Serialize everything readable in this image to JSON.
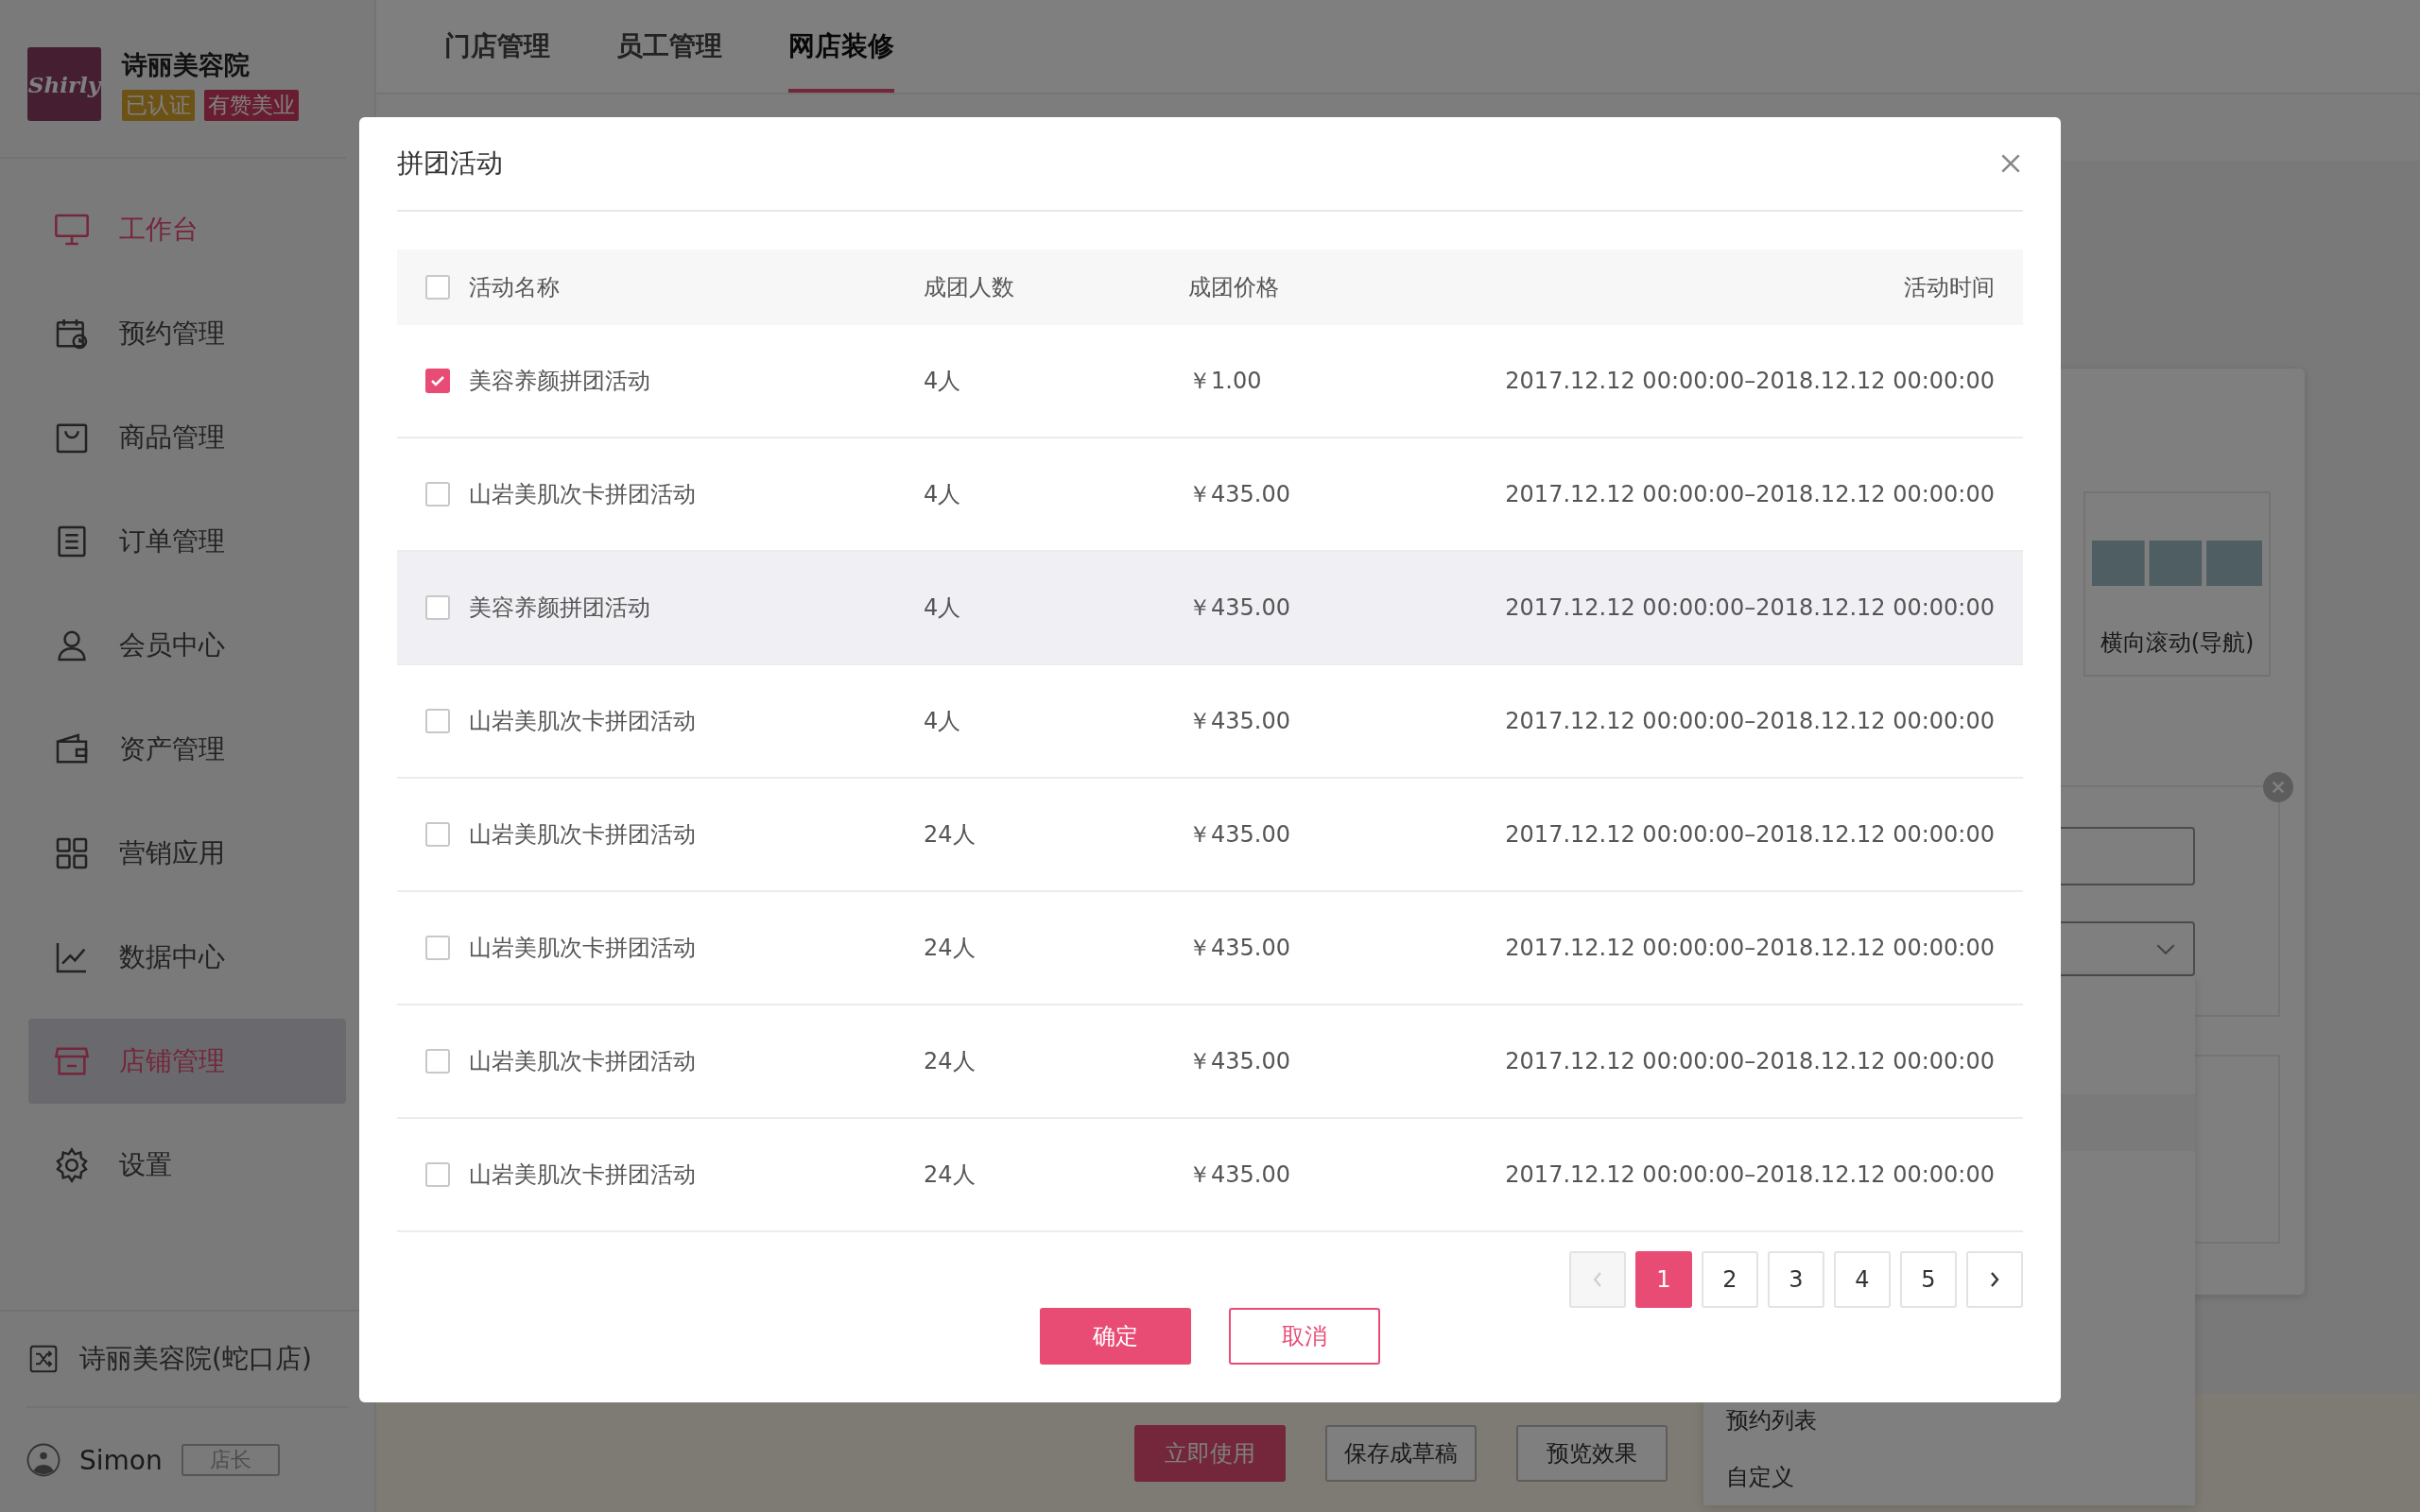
{
  "store": {
    "logo": "Shirly",
    "name": "诗丽美容院",
    "badges": [
      "已认证",
      "有赞美业"
    ]
  },
  "nav": [
    {
      "label": "工作台",
      "active": true,
      "selected": false
    },
    {
      "label": "预约管理",
      "active": false,
      "selected": false
    },
    {
      "label": "商品管理",
      "active": false,
      "selected": false
    },
    {
      "label": "订单管理",
      "active": false,
      "selected": false
    },
    {
      "label": "会员中心",
      "active": false,
      "selected": false
    },
    {
      "label": "资产管理",
      "active": false,
      "selected": false
    },
    {
      "label": "营销应用",
      "active": false,
      "selected": false
    },
    {
      "label": "数据中心",
      "active": false,
      "selected": false
    },
    {
      "label": "店铺管理",
      "active": true,
      "selected": true
    },
    {
      "label": "设置",
      "active": false,
      "selected": false
    }
  ],
  "store_switch": "诗丽美容院(蛇口店)",
  "user": {
    "name": "Simon",
    "role": "店长"
  },
  "tabs": [
    {
      "label": "门店管理",
      "selected": false
    },
    {
      "label": "员工管理",
      "selected": false
    },
    {
      "label": "网店装修",
      "selected": true
    }
  ],
  "component_tile": {
    "label": "横向滚动(导航)"
  },
  "dropdown_items": [
    "预约列表",
    "自定义"
  ],
  "bottom_buttons": [
    {
      "label": "立即使用",
      "kind": "primary"
    },
    {
      "label": "保存成草稿",
      "kind": "default"
    },
    {
      "label": "预览效果",
      "kind": "default"
    }
  ],
  "modal": {
    "title": "拼团活动",
    "columns": [
      "活动名称",
      "成团人数",
      "成团价格",
      "活动时间"
    ],
    "all_checked": false,
    "rows": [
      {
        "name": "美容养颜拼团活动",
        "size": "4人",
        "price": "￥1.00",
        "time": "2017.12.12 00:00:00–2018.12.12 00:00:00",
        "checked": true,
        "hovered": false
      },
      {
        "name": "山岩美肌次卡拼团活动",
        "size": "4人",
        "price": "￥435.00",
        "time": "2017.12.12 00:00:00–2018.12.12 00:00:00",
        "checked": false,
        "hovered": false
      },
      {
        "name": "美容养颜拼团活动",
        "size": "4人",
        "price": "￥435.00",
        "time": "2017.12.12 00:00:00–2018.12.12 00:00:00",
        "checked": false,
        "hovered": true
      },
      {
        "name": "山岩美肌次卡拼团活动",
        "size": "4人",
        "price": "￥435.00",
        "time": "2017.12.12 00:00:00–2018.12.12 00:00:00",
        "checked": false,
        "hovered": false
      },
      {
        "name": "山岩美肌次卡拼团活动",
        "size": "24人",
        "price": "￥435.00",
        "time": "2017.12.12 00:00:00–2018.12.12 00:00:00",
        "checked": false,
        "hovered": false
      },
      {
        "name": "山岩美肌次卡拼团活动",
        "size": "24人",
        "price": "￥435.00",
        "time": "2017.12.12 00:00:00–2018.12.12 00:00:00",
        "checked": false,
        "hovered": false
      },
      {
        "name": "山岩美肌次卡拼团活动",
        "size": "24人",
        "price": "￥435.00",
        "time": "2017.12.12 00:00:00–2018.12.12 00:00:00",
        "checked": false,
        "hovered": false
      },
      {
        "name": "山岩美肌次卡拼团活动",
        "size": "24人",
        "price": "￥435.00",
        "time": "2017.12.12 00:00:00–2018.12.12 00:00:00",
        "checked": false,
        "hovered": false
      }
    ],
    "pages": [
      {
        "label": "1",
        "selected": true
      },
      {
        "label": "2",
        "selected": false
      },
      {
        "label": "3",
        "selected": false
      },
      {
        "label": "4",
        "selected": false
      },
      {
        "label": "5",
        "selected": false
      }
    ],
    "prev_disabled": true,
    "confirm": "确定",
    "cancel": "取消"
  }
}
